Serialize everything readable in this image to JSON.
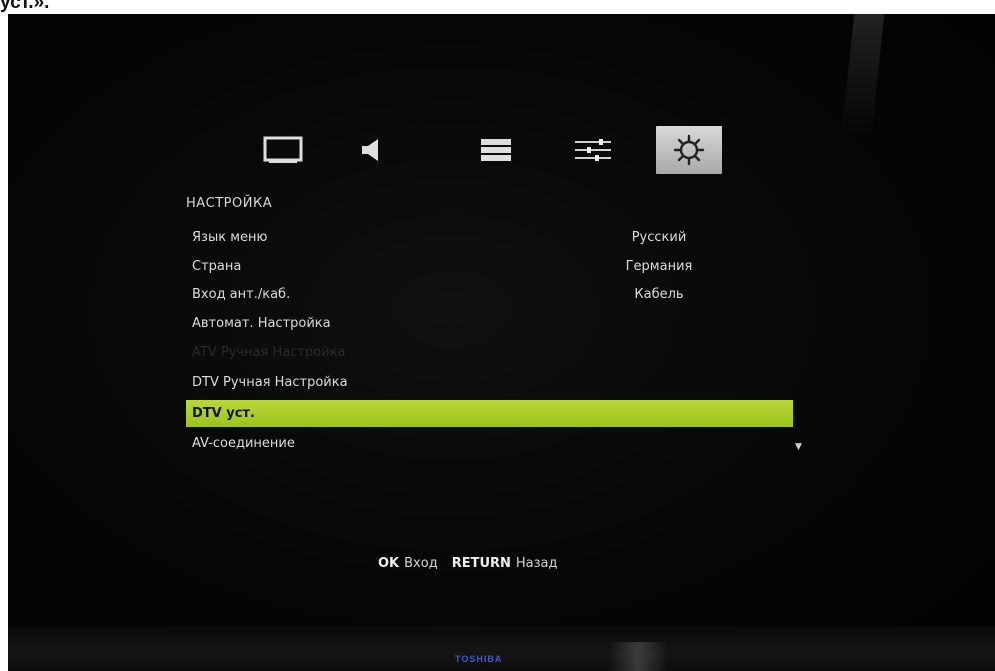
{
  "caption_fragment": "уст.».",
  "icons": {
    "picture": "tv-screen-icon",
    "sound": "speaker-icon",
    "channels": "channel-list-icon",
    "adjust": "sliders-icon",
    "setup": "gear-icon"
  },
  "menu": {
    "title": "НАСТРОЙКА",
    "items": [
      {
        "label": "Язык меню",
        "value": "Русский"
      },
      {
        "label": "Страна",
        "value": "Германия"
      },
      {
        "label": "Вход ант./каб.",
        "value": "Кабель"
      },
      {
        "label": "Автомат. Настройка",
        "value": ""
      },
      {
        "label": "ATV Ручная Настройка",
        "value": "",
        "state": "disabled"
      },
      {
        "label": "DTV Ручная Настройка",
        "value": ""
      },
      {
        "label": "DTV уст.",
        "value": "",
        "state": "selected"
      },
      {
        "label": "AV-соединение",
        "value": ""
      }
    ],
    "scroll_indicator": "▼"
  },
  "hints": {
    "ok_key": "OK",
    "ok_action": "Вход",
    "return_key": "RETURN",
    "return_action": "Назад"
  },
  "brand": "TOSHIBA",
  "colors": {
    "highlight": "#a8cc26",
    "text": "#dcdcdc",
    "background": "#050505"
  }
}
